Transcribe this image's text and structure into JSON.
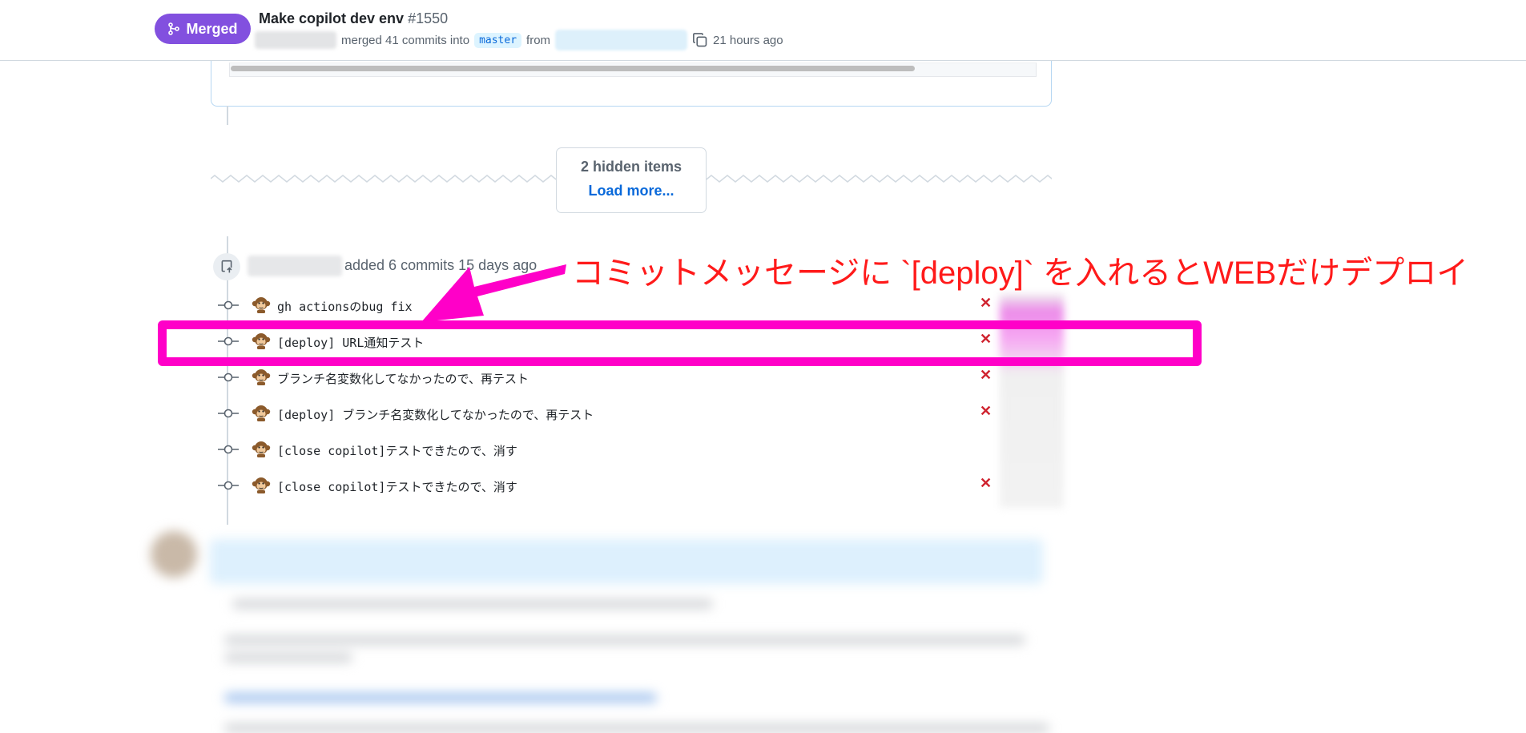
{
  "header": {
    "status_label": "Merged",
    "title": "Make copilot dev env",
    "number": "#1550",
    "merged_text": "merged 41 commits into",
    "base_branch": "master",
    "from_text": "from",
    "time_ago": "21 hours ago"
  },
  "hidden": {
    "count_label": "2 hidden items",
    "load_more_label": "Load more..."
  },
  "push_event": {
    "text": "added 6 commits 15 days ago"
  },
  "commits": [
    {
      "message": "gh actionsのbug fix",
      "failed": true
    },
    {
      "message": "[deploy] URL通知テスト",
      "failed": true
    },
    {
      "message": "ブランチ名変数化してなかったので、再テスト",
      "failed": true
    },
    {
      "message": "[deploy] ブランチ名変数化してなかったので、再テスト",
      "failed": true
    },
    {
      "message": "[close copilot]テストできたので、消す",
      "failed": false
    },
    {
      "message": "[close copilot]テストできたので、消す",
      "failed": true
    }
  ],
  "status_fail_glyph": "✕",
  "annotation": {
    "text": "コミットメッセージに `[deploy]` を入れるとWEBだけデプロイ",
    "color": "#ff1a1a",
    "highlight_color": "#ff00c8"
  },
  "colors": {
    "merged": "#8250df",
    "link": "#0969da",
    "fail": "#cf222e"
  }
}
